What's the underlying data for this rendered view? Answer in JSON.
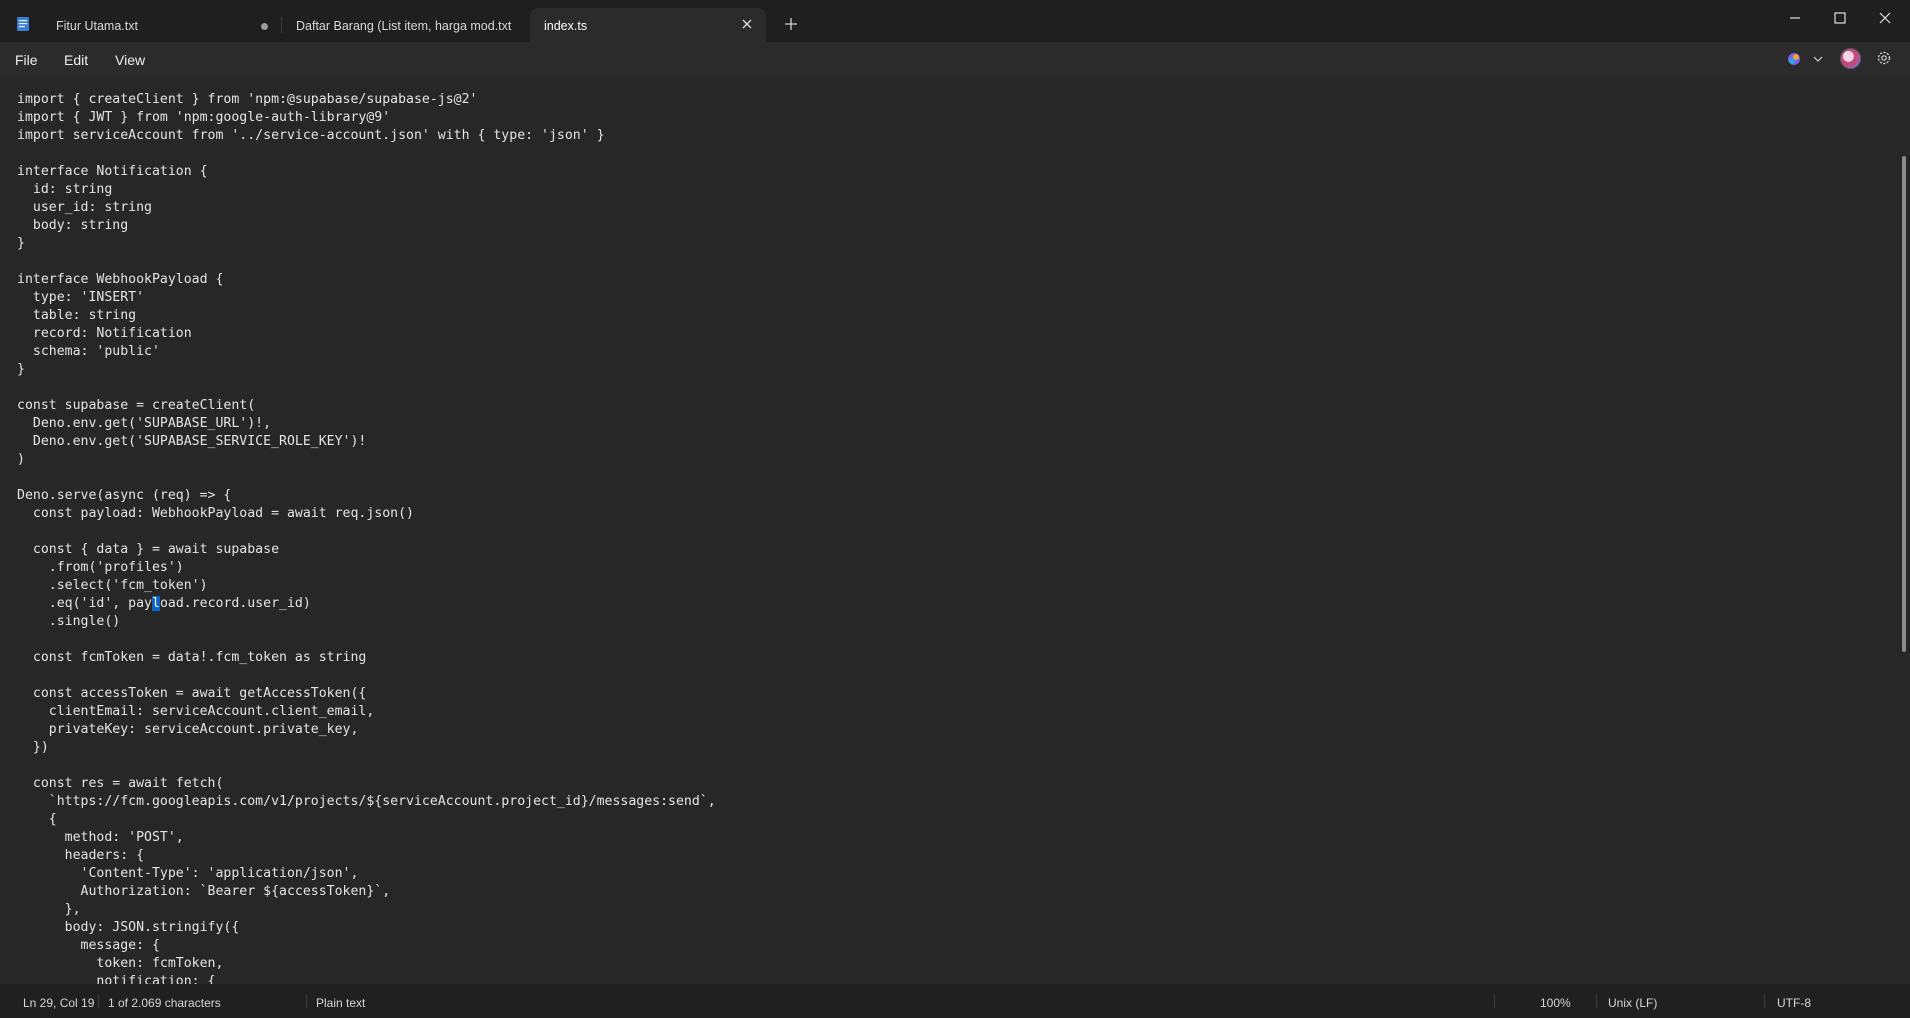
{
  "tabs": [
    {
      "label": "Fitur Utama.txt",
      "state": "unsaved"
    },
    {
      "label": "Daftar Barang (List item, harga mod.txt",
      "state": "saved"
    },
    {
      "label": "index.ts",
      "state": "active"
    }
  ],
  "menu": {
    "file": "File",
    "edit": "Edit",
    "view": "View"
  },
  "icons": {
    "app": "notepad-icon",
    "new_tab": "plus-icon",
    "close": "close-icon",
    "minimize": "minimize-icon",
    "maximize": "maximize-icon",
    "window_close": "window-close-icon",
    "copilot": "copilot-icon",
    "settings": "gear-icon"
  },
  "colors": {
    "accent": "#0a64c2",
    "editor_bg": "#272727",
    "titlebar_bg": "#1f1f1f"
  },
  "editor": {
    "before_selection": "import { createClient } from 'npm:@supabase/supabase-js@2'\nimport { JWT } from 'npm:google-auth-library@9'\nimport serviceAccount from '../service-account.json' with { type: 'json' }\n\ninterface Notification {\n  id: string\n  user_id: string\n  body: string\n}\n\ninterface WebhookPayload {\n  type: 'INSERT'\n  table: string\n  record: Notification\n  schema: 'public'\n}\n\nconst supabase = createClient(\n  Deno.env.get('SUPABASE_URL')!,\n  Deno.env.get('SUPABASE_SERVICE_ROLE_KEY')!\n)\n\nDeno.serve(async (req) => {\n  const payload: WebhookPayload = await req.json()\n\n  const { data } = await supabase\n    .from('profiles')\n    .select('fcm_token')\n    .eq('id', pay",
    "selection": "l",
    "after_selection": "oad.record.user_id)\n    .single()\n\n  const fcmToken = data!.fcm_token as string\n\n  const accessToken = await getAccessToken({\n    clientEmail: serviceAccount.client_email,\n    privateKey: serviceAccount.private_key,\n  })\n\n  const res = await fetch(\n    `https://fcm.googleapis.com/v1/projects/${serviceAccount.project_id}/messages:send`,\n    {\n      method: 'POST',\n      headers: {\n        'Content-Type': 'application/json',\n        Authorization: `Bearer ${accessToken}`,\n      },\n      body: JSON.stringify({\n        message: {\n          token: fcmToken,\n          notification: {"
  },
  "status": {
    "position": "Ln 29, Col 19",
    "selection": "1 of 2.069 characters",
    "language": "Plain text",
    "zoom": "100%",
    "line_ending": "Unix (LF)",
    "encoding": "UTF-8"
  }
}
